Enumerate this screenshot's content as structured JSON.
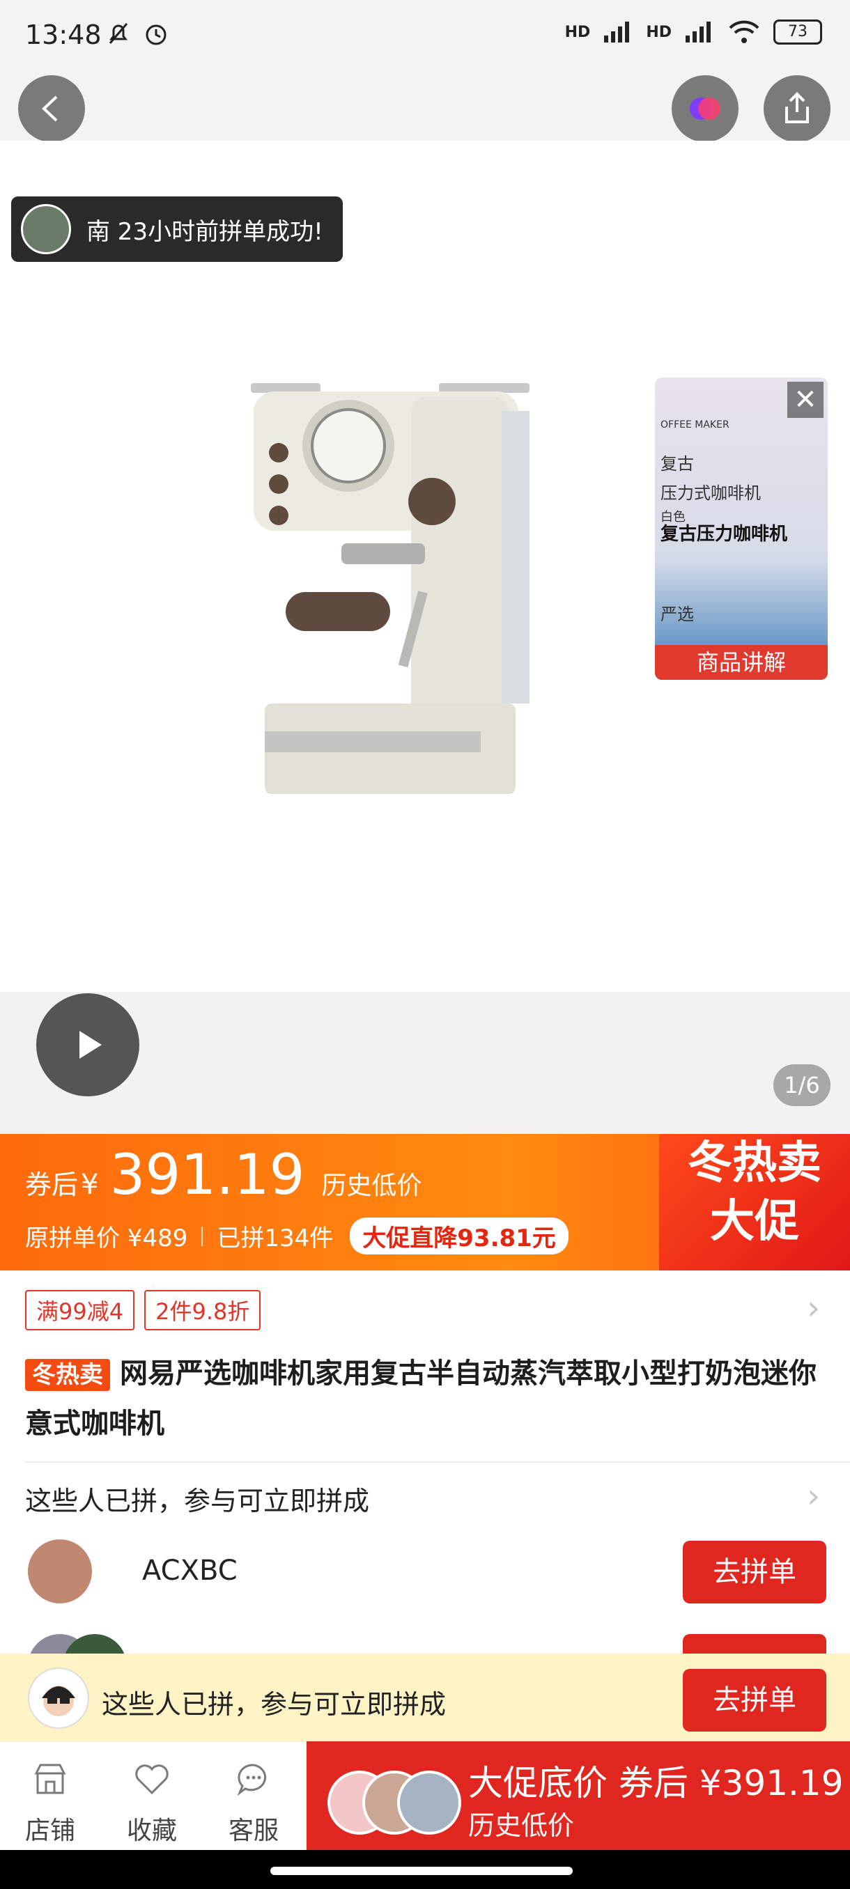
{
  "status_bar": {
    "time": "13:48",
    "battery": "73",
    "hd": "HD"
  },
  "header": {
    "back_icon": "chevron-left-icon",
    "share_icon": "share-icon",
    "brand_icon": "brand-circle-icon"
  },
  "toast": {
    "text": "南 23小时前拼单成功!"
  },
  "thumbnail": {
    "lines": [
      "OFFEE MAKER",
      "复古",
      "压力式咖啡机",
      "白色",
      "复古压力咖啡机",
      "严选"
    ],
    "label": "商品讲解",
    "close": "✕"
  },
  "gallery": {
    "pager": "1/6"
  },
  "price": {
    "after_coupon": "券后",
    "currency": "¥",
    "value": "391.19",
    "history": "历史低价",
    "original_label": "原拼单价 ¥489",
    "sold": "已拼134件",
    "drop": "大促直降93.81元",
    "promo_line1": "冬热卖",
    "promo_line2": "大促"
  },
  "coupons": [
    "满99减4",
    "2件9.8折"
  ],
  "product": {
    "tag": "冬热卖",
    "title": "网易严选咖啡机家用复古半自动蒸汽萃取小型打奶泡迷你意式咖啡机"
  },
  "group": {
    "title": "这些人已拼，参与可立即拼成",
    "rows": [
      {
        "name": "ACXBC",
        "button": "去拼单"
      }
    ]
  },
  "sticky": {
    "text": "这些人已拼，参与可立即拼成",
    "button": "去拼单"
  },
  "bottom_bar": {
    "store": "店铺",
    "favorite": "收藏",
    "service": "客服",
    "buy_line1": "大促底价 券后 ¥391.19",
    "buy_line2": "历史低价"
  },
  "colors": {
    "accent": "#e0271f",
    "orange": "#ff7a0c"
  }
}
